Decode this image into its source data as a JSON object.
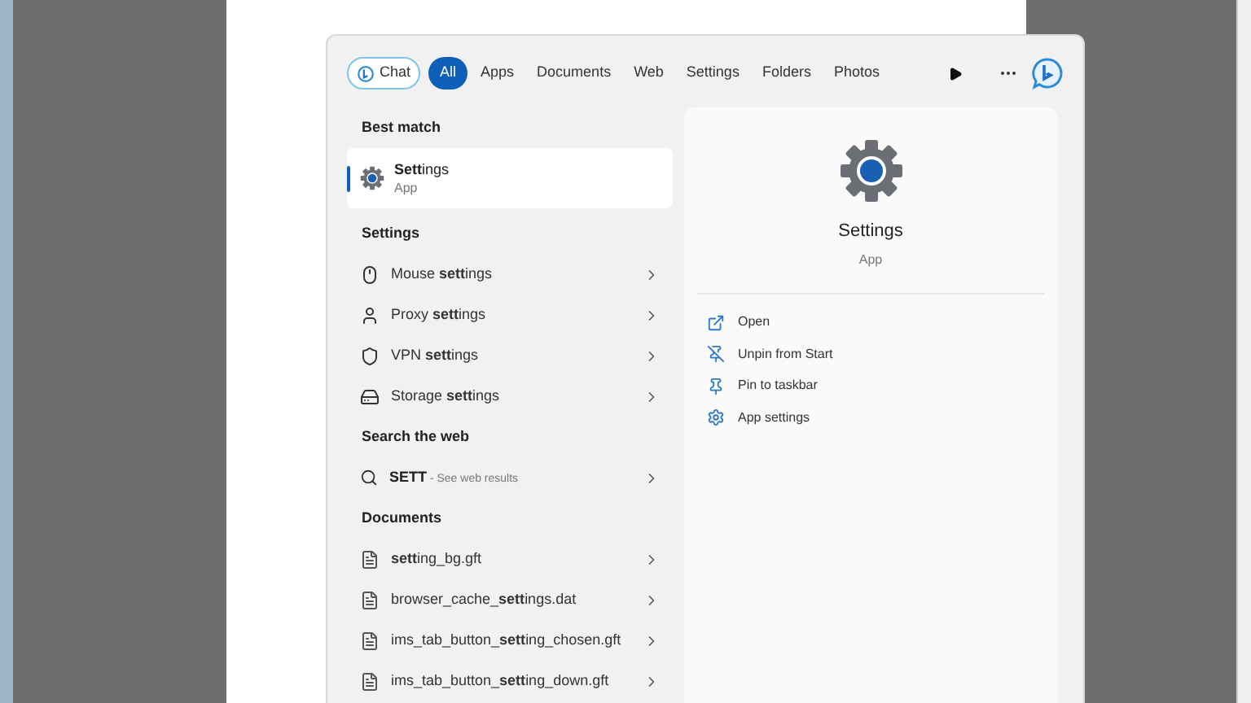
{
  "search_panel": {
    "chat_button": "Chat",
    "tabs": [
      {
        "label": "All",
        "selected": true
      },
      {
        "label": "Apps",
        "selected": false
      },
      {
        "label": "Documents",
        "selected": false
      },
      {
        "label": "Web",
        "selected": false
      },
      {
        "label": "Settings",
        "selected": false
      },
      {
        "label": "Folders",
        "selected": false
      },
      {
        "label": "Photos",
        "selected": false
      }
    ],
    "best_match": {
      "heading": "Best match",
      "title": "**Sett**ings",
      "subtitle": "App",
      "selected": true
    },
    "settings": {
      "heading": "Settings",
      "items": [
        {
          "kind": "mouse",
          "label": "Mouse **sett**ings"
        },
        {
          "kind": "proxy",
          "label": "Proxy **sett**ings"
        },
        {
          "kind": "vpn",
          "label": "VPN **sett**ings"
        },
        {
          "kind": "storage",
          "label": "Storage **sett**ings"
        }
      ]
    },
    "web": {
      "heading": "Search the web",
      "query": "SETT",
      "hint": " - See web results"
    },
    "documents": {
      "heading": "Documents",
      "items": [
        {
          "label": "**sett**ing_bg.gft"
        },
        {
          "label": "browser_cache_**sett**ings.dat"
        },
        {
          "label": "ims_tab_button_**sett**ing_chosen.gft"
        },
        {
          "label": "ims_tab_button_**sett**ing_down.gft"
        }
      ]
    },
    "preview": {
      "title": "Settings",
      "subtitle": "App",
      "actions": [
        {
          "kind": "open",
          "label": "Open"
        },
        {
          "kind": "unpin",
          "label": "Unpin from Start"
        },
        {
          "kind": "pin",
          "label": "Pin to taskbar"
        },
        {
          "kind": "settings",
          "label": "App settings"
        }
      ]
    }
  }
}
